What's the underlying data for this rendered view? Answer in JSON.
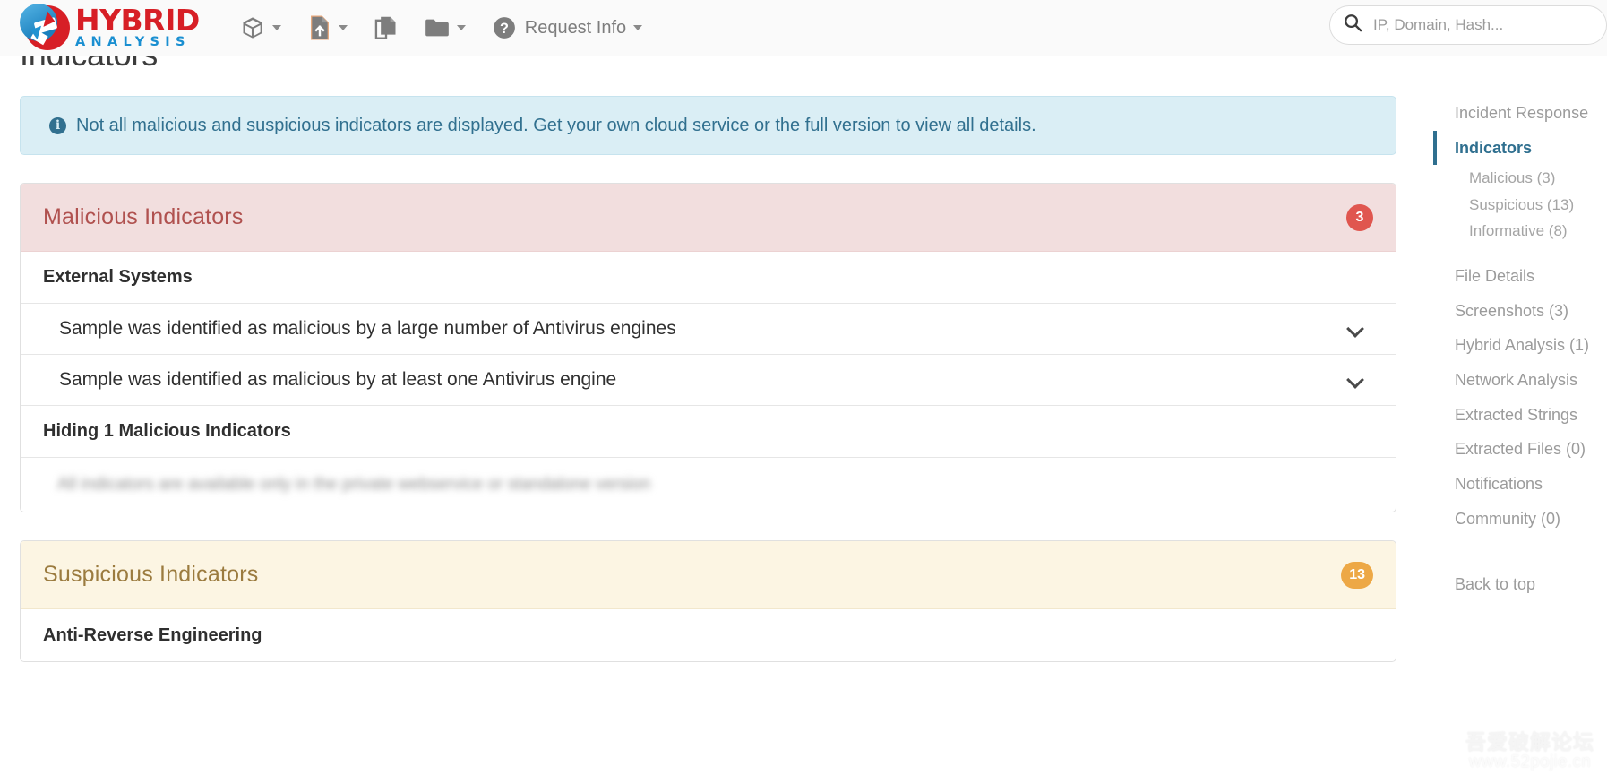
{
  "brand": {
    "name_primary": "HYBRID",
    "name_secondary": "ANALYSIS"
  },
  "topnav": {
    "items": [
      {
        "icon": "cube-icon",
        "label": "",
        "has_caret": true
      },
      {
        "icon": "file-upload-icon",
        "label": "",
        "has_caret": true
      },
      {
        "icon": "copy-files-icon",
        "label": "",
        "has_caret": false
      },
      {
        "icon": "folder-icon",
        "label": "",
        "has_caret": true
      },
      {
        "icon": "question-circle-icon",
        "label": "Request Info",
        "has_caret": true
      }
    ],
    "request_info_label": "Request Info"
  },
  "search": {
    "placeholder": "IP, Domain, Hash...",
    "value": "",
    "icon": "search-icon"
  },
  "page": {
    "title": "Indicators"
  },
  "alert": {
    "icon": "info-icon",
    "badge_char": "i",
    "text": "Not all malicious and suspicious indicators are displayed. Get your own cloud service or the full version to view all details."
  },
  "panels": [
    {
      "id": "malicious",
      "title": "Malicious Indicators",
      "count": "3",
      "badge_color": "#e0564f",
      "rows": [
        {
          "type": "group",
          "text": "External Systems"
        },
        {
          "type": "item",
          "text": "Sample was identified as malicious by a large number of Antivirus engines",
          "chevron": "chevron-down-icon"
        },
        {
          "type": "item",
          "text": "Sample was identified as malicious by at least one Antivirus engine",
          "chevron": "chevron-down-icon"
        },
        {
          "type": "group",
          "text": "Hiding 1 Malicious Indicators"
        },
        {
          "type": "blurred",
          "text": "All indicators are available only in the private webservice or standalone version"
        }
      ]
    },
    {
      "id": "suspicious",
      "title": "Suspicious Indicators",
      "count": "13",
      "badge_color": "#eda846",
      "rows": [
        {
          "type": "group",
          "text": "Anti-Reverse Engineering"
        }
      ]
    }
  ],
  "sidebar": {
    "items": [
      {
        "label": "Incident Response",
        "level": "top",
        "active": false
      },
      {
        "label": "Indicators",
        "level": "top",
        "active": true
      },
      {
        "label": "Malicious (3)",
        "level": "sub",
        "active": false
      },
      {
        "label": "Suspicious (13)",
        "level": "sub",
        "active": false
      },
      {
        "label": "Informative (8)",
        "level": "sub",
        "active": false
      },
      {
        "label": "File Details",
        "level": "top",
        "active": false
      },
      {
        "label": "Screenshots (3)",
        "level": "top",
        "active": false
      },
      {
        "label": "Hybrid Analysis (1)",
        "level": "top",
        "active": false
      },
      {
        "label": "Network Analysis",
        "level": "top",
        "active": false
      },
      {
        "label": "Extracted Strings",
        "level": "top",
        "active": false
      },
      {
        "label": "Extracted Files (0)",
        "level": "top",
        "active": false
      },
      {
        "label": "Notifications",
        "level": "top",
        "active": false
      },
      {
        "label": "Community (0)",
        "level": "top",
        "active": false
      }
    ],
    "back_to_top": "Back to top"
  },
  "watermark": {
    "line1": "吾爱破解论坛",
    "line2": "www.52pojie.cn"
  }
}
